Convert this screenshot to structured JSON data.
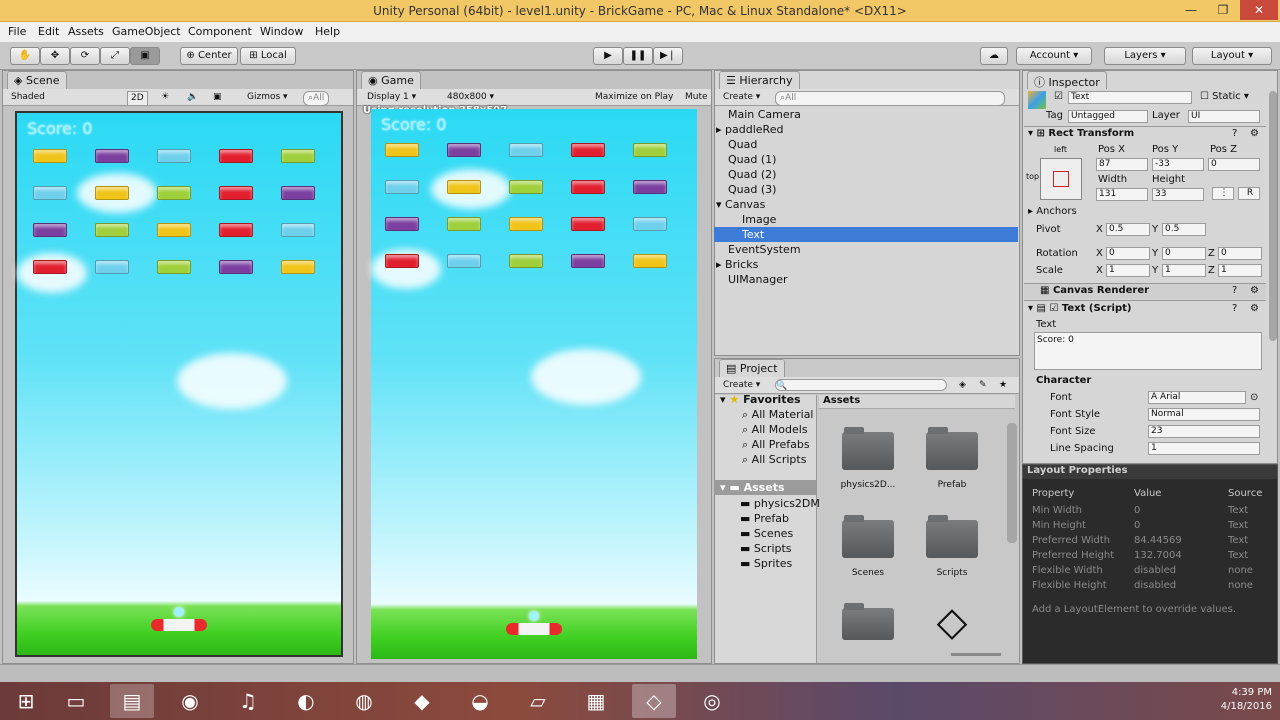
{
  "window": {
    "title": "Unity Personal (64bit) - level1.unity - BrickGame - PC, Mac & Linux Standalone* <DX11>"
  },
  "menu": [
    "File",
    "Edit",
    "Assets",
    "GameObject",
    "Component",
    "Window",
    "Help"
  ],
  "toolbar": {
    "center": "Center",
    "local": "Local",
    "account": "Account",
    "layers": "Layers",
    "layout": "Layout"
  },
  "scene": {
    "tab": "Scene",
    "shaded": "Shaded",
    "mode2d": "2D",
    "gizmos": "Gizmos",
    "search": "⌕All",
    "score": "Score: 0"
  },
  "game": {
    "tab": "Game",
    "display": "Display 1",
    "resolution": "480x800",
    "maximize": "Maximize on Play",
    "mute": "Mute",
    "using": "Using resolution 358x597",
    "score": "Score: 0"
  },
  "hierarchy": {
    "tab": "Hierarchy",
    "create": "Create",
    "search": "⌕All",
    "items": [
      "Main Camera",
      "paddleRed",
      "Quad",
      "Quad (1)",
      "Quad (2)",
      "Quad (3)",
      "Canvas",
      "Image",
      "Text",
      "EventSystem",
      "Bricks",
      "UIManager"
    ]
  },
  "project": {
    "tab": "Project",
    "create": "Create",
    "favorites": "Favorites",
    "fav_items": [
      "All Material",
      "All Models",
      "All Prefabs",
      "All Scripts"
    ],
    "assets_root": "Assets",
    "tree": [
      "physics2DM",
      "Prefab",
      "Scenes",
      "Scripts",
      "Sprites"
    ],
    "crumb": "Assets",
    "folders": [
      "physics2D...",
      "Prefab",
      "Scenes",
      "Scripts"
    ]
  },
  "inspector": {
    "tab": "Inspector",
    "name": "Text",
    "static": "Static",
    "tag_label": "Tag",
    "tag": "Untagged",
    "layer_label": "Layer",
    "layer": "UI",
    "rect": "Rect Transform",
    "left": "left",
    "top": "top",
    "posx_l": "Pos X",
    "posy_l": "Pos Y",
    "posz_l": "Pos Z",
    "posx": "87",
    "posy": "-33",
    "posz": "0",
    "width_l": "Width",
    "height_l": "Height",
    "width": "131",
    "height": "33",
    "r_btn": "R",
    "anchors": "Anchors",
    "pivot": "Pivot",
    "pivx": "0.5",
    "pivy": "0.5",
    "rotation": "Rotation",
    "rotx": "0",
    "roty": "0",
    "rotz": "0",
    "scale": "Scale",
    "sx": "1",
    "sy": "1",
    "sz": "1",
    "x": "X",
    "y": "Y",
    "z": "Z",
    "canvas_renderer": "Canvas Renderer",
    "text_script": "Text (Script)",
    "text_label": "Text",
    "text_value": "Score: 0",
    "character": "Character",
    "font_l": "Font",
    "font": "Arial",
    "fontstyle_l": "Font Style",
    "fontstyle": "Normal",
    "fontsize_l": "Font Size",
    "fontsize": "23",
    "linesp_l": "Line Spacing",
    "linesp": "1"
  },
  "layout_props": {
    "title": "Layout Properties",
    "headers": [
      "Property",
      "Value",
      "Source"
    ],
    "rows": [
      [
        "Min Width",
        "0",
        "Text"
      ],
      [
        "Min Height",
        "0",
        "Text"
      ],
      [
        "Preferred Width",
        "84.44569",
        "Text"
      ],
      [
        "Preferred Height",
        "132.7004",
        "Text"
      ],
      [
        "Flexible Width",
        "disabled",
        "none"
      ],
      [
        "Flexible Height",
        "disabled",
        "none"
      ]
    ],
    "note": "Add a LayoutElement to override values."
  },
  "clock": {
    "time": "4:39 PM",
    "date": "4/18/2016"
  }
}
